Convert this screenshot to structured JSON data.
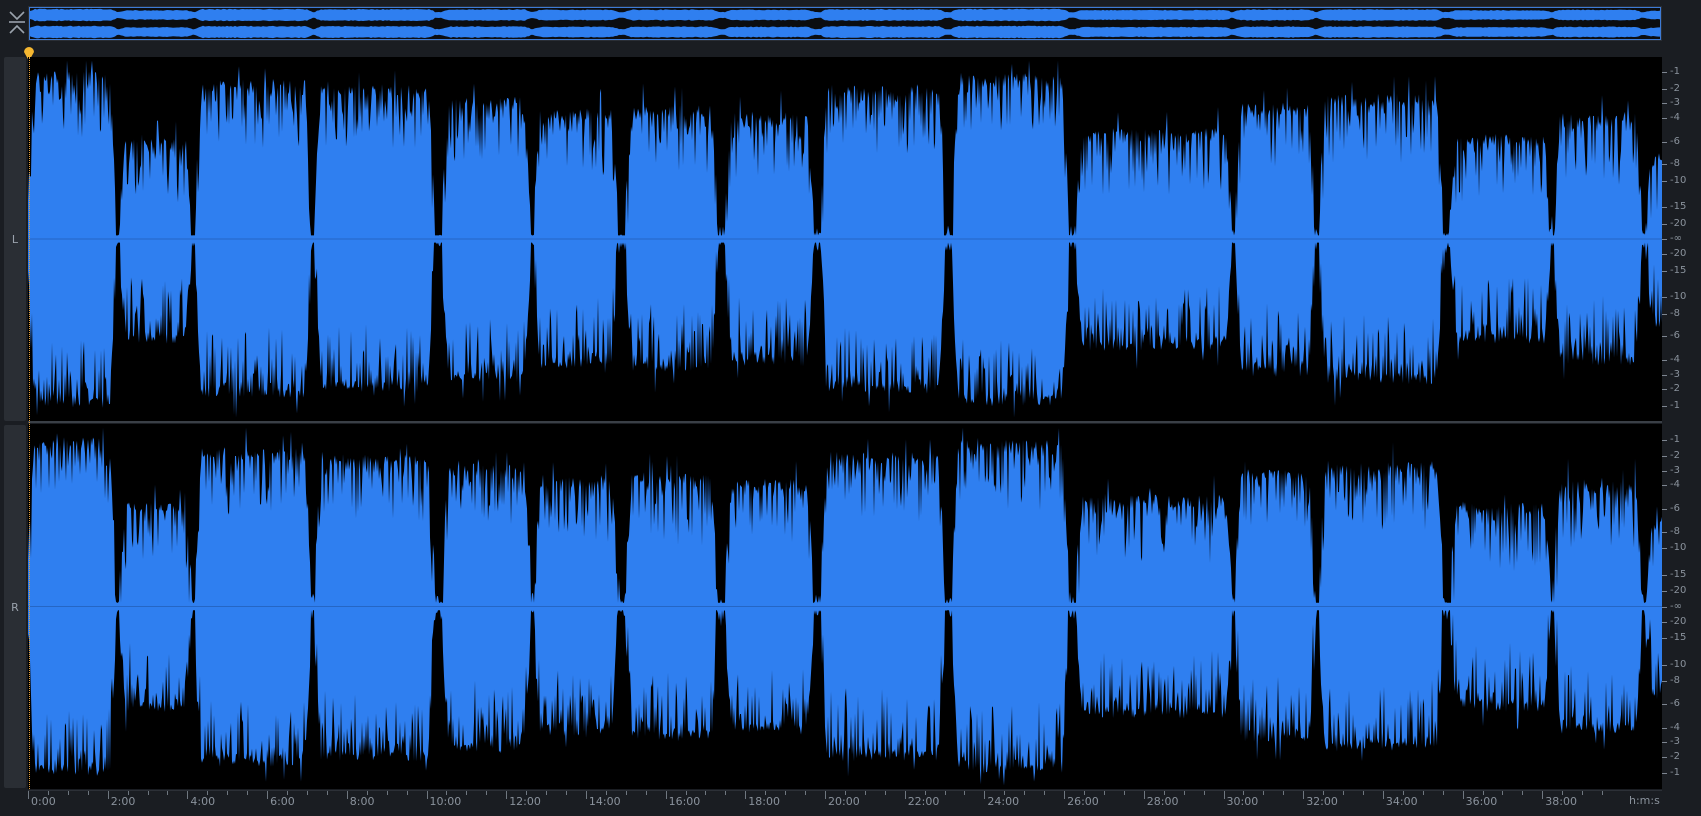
{
  "app": {
    "title": ""
  },
  "colors": {
    "waveform": "#2f7ff0",
    "background": "#000000",
    "chrome": "#1a1d22",
    "playhead": "#f5b731",
    "overview_border": "#3d7bd6"
  },
  "toolbar": {
    "collapse_icon": "collapse-expand-icon"
  },
  "channels": [
    {
      "label": "L"
    },
    {
      "label": "R"
    }
  ],
  "db_scale": {
    "unit": "dB",
    "left_labels": [
      "-1",
      "-2",
      "-3",
      "-4",
      "-6",
      "-8",
      "-10",
      "-15",
      "-20",
      "-∞",
      "-20",
      "-15",
      "-10",
      "-8",
      "-6",
      "-4",
      "-3",
      "-2",
      "-1"
    ],
    "right_labels": [
      "-1",
      "-2",
      "-3",
      "-4",
      "-6",
      "-8",
      "-10",
      "-15",
      "-20",
      "-∞",
      "-20",
      "-15",
      "-10",
      "-8",
      "-6",
      "-4",
      "-3",
      "-2",
      "-1"
    ]
  },
  "timeline": {
    "unit": "h:m:s",
    "labels": [
      "0:00",
      "2:00",
      "4:00",
      "6:00",
      "8:00",
      "10:00",
      "12:00",
      "14:00",
      "16:00",
      "18:00",
      "20:00",
      "22:00",
      "24:00",
      "26:00",
      "28:00",
      "30:00",
      "32:00",
      "34:00",
      "36:00",
      "38:00"
    ]
  },
  "waveform_segments_minutes": [
    [
      0.0,
      2.2,
      0.93
    ],
    [
      2.3,
      4.1,
      0.58
    ],
    [
      4.2,
      7.1,
      0.88
    ],
    [
      7.2,
      10.2,
      0.85
    ],
    [
      10.4,
      12.6,
      0.8
    ],
    [
      12.7,
      14.8,
      0.72
    ],
    [
      15.0,
      17.3,
      0.74
    ],
    [
      17.5,
      19.7,
      0.7
    ],
    [
      19.9,
      23.0,
      0.85
    ],
    [
      23.2,
      26.1,
      0.92
    ],
    [
      26.3,
      30.2,
      0.62
    ],
    [
      30.3,
      32.3,
      0.76
    ],
    [
      32.4,
      35.5,
      0.8
    ],
    [
      35.7,
      38.2,
      0.58
    ],
    [
      38.3,
      40.5,
      0.7
    ],
    [
      40.6,
      41.3,
      0.5
    ]
  ]
}
